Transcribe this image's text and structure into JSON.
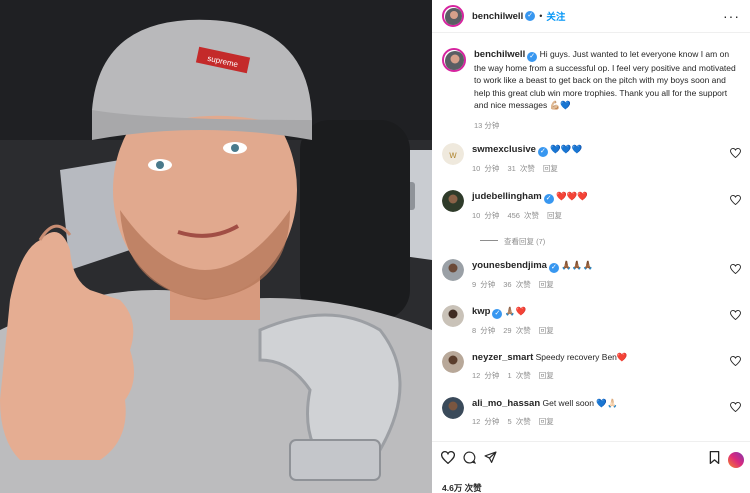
{
  "post": {
    "username": "benchilwell",
    "follow_dot": "•",
    "follow_label": "关注",
    "more_label": "···"
  },
  "caption": {
    "username": "benchilwell",
    "text": "Hi guys. Just wanted to let everyone know I am on the way home from a successful op. I feel very positive and motivated to work like a beast to get back on the pitch with my boys soon and help this great club win more trophies. Thank you all for the support and nice messages 💪🏼💙",
    "time": "13 分钟"
  },
  "photo": {
    "beanie_label": "supreme"
  },
  "comments": [
    {
      "username": "swmexclusive",
      "text": "💙💙💙",
      "time": "10 分钟",
      "likes": "31 次赞",
      "reply": "回复"
    },
    {
      "username": "judebellingham",
      "text": "❤️❤️❤️",
      "time": "10 分钟",
      "likes": "456 次赞",
      "reply": "回复"
    },
    {
      "username": "younesbendjima",
      "text": "🙏🏾🙏🏾🙏🏾",
      "time": "9 分钟",
      "likes": "36 次赞",
      "reply": "回复"
    },
    {
      "username": "kwp",
      "text": "🙏🏽❤️",
      "time": "8 分钟",
      "likes": "29 次赞",
      "reply": "回复"
    },
    {
      "username": "neyzer_smart",
      "text": "Speedy recovery Ben❤️",
      "time": "12 分钟",
      "likes": "1 次赞",
      "reply": "回复"
    },
    {
      "username": "ali_mo_hassan",
      "text": "Get well soon 💙🙏🏻",
      "time": "12 分钟",
      "likes": "5 次赞",
      "reply": "回复"
    }
  ],
  "view_replies": "查看回复 (7)",
  "footer": {
    "likes": "4.6万 次赞"
  },
  "colors": {
    "accent": "#0095f6",
    "verified": "#3897f0",
    "muted": "#8e8e8e"
  }
}
